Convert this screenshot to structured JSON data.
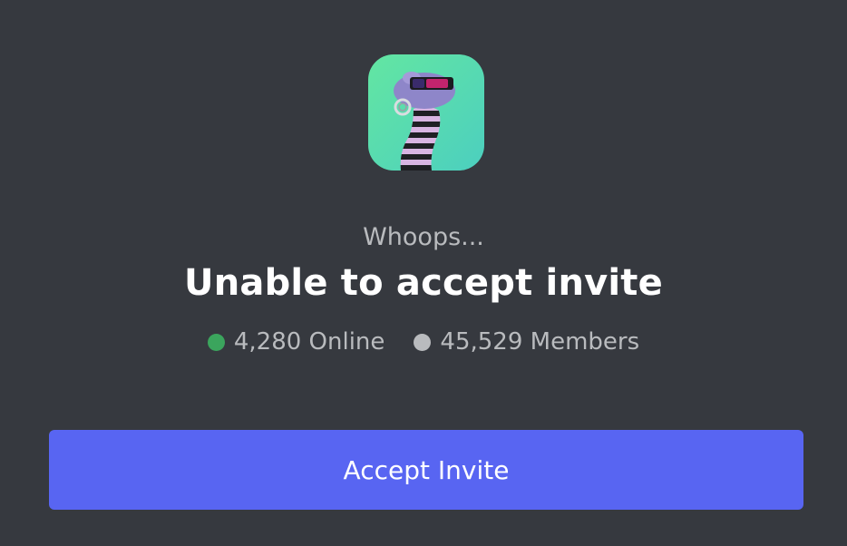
{
  "invite": {
    "subtitle": "Whoops...",
    "title": "Unable to accept invite",
    "online": {
      "label": "4,280 Online",
      "dot_color": "#3ba55d"
    },
    "members": {
      "label": "45,529 Members",
      "dot_color": "#b9bbbe"
    },
    "accept_button": {
      "label": "Accept Invite",
      "color": "#5865f2"
    }
  },
  "server_icon": {
    "icon_name": "striped-worm-with-sunglasses-logo",
    "background_colors": [
      "#5ee0a8",
      "#4fd1c5"
    ]
  },
  "colors": {
    "background": "#36393f",
    "text_primary": "#ffffff",
    "text_secondary": "#b9bbbe"
  }
}
